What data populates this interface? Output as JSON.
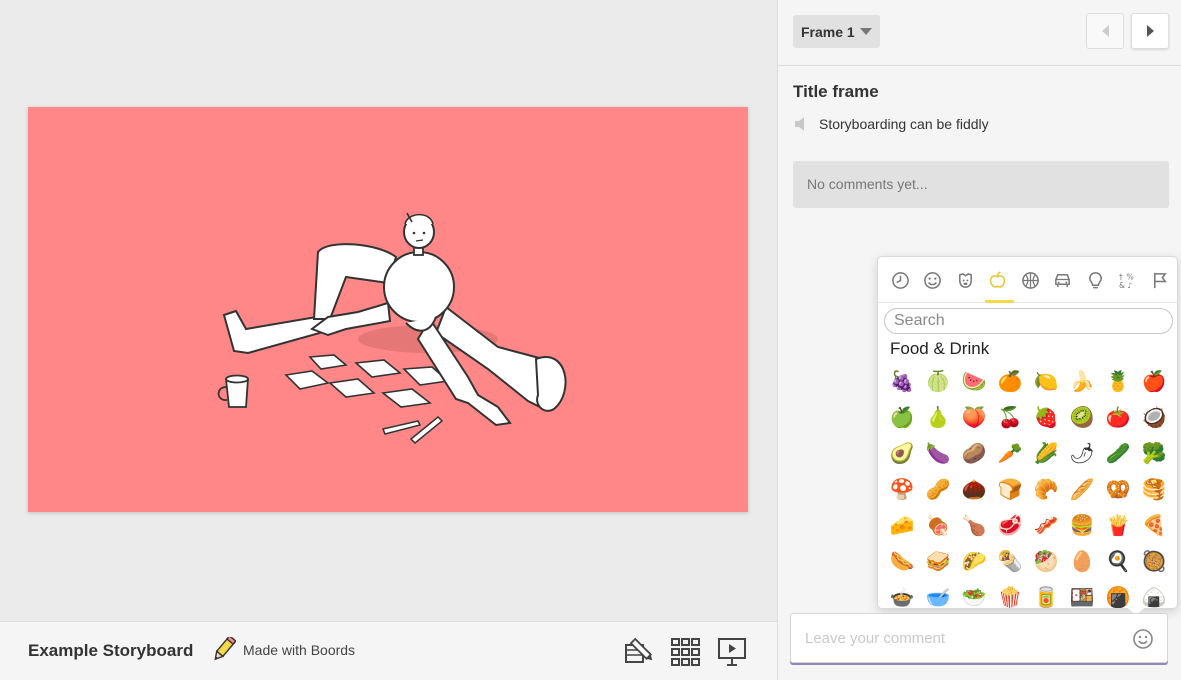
{
  "footer": {
    "project_title": "Example Storyboard",
    "made_with": "Made with Boords",
    "icons": [
      "edit-frames-icon",
      "grid-view-icon",
      "presentation-icon"
    ]
  },
  "sidebar": {
    "frame_select": "Frame 1",
    "frame_title": "Title frame",
    "frame_note": "Storyboarding can be fiddly",
    "comments_empty": "No comments yet..."
  },
  "emoji_picker": {
    "categories": [
      "recent-icon",
      "smileys-icon",
      "animals-icon",
      "food-icon",
      "activity-icon",
      "travel-icon",
      "objects-icon",
      "symbols-icon",
      "flags-icon"
    ],
    "active_category": "food-icon",
    "search_placeholder": "Search",
    "section_title": "Food & Drink",
    "emojis": [
      "🍇",
      "🍈",
      "🍉",
      "🍊",
      "🍋",
      "🍌",
      "🍍",
      "🍎",
      "🍏",
      "🍐",
      "🍑",
      "🍒",
      "🍓",
      "🥝",
      "🍅",
      "🥥",
      "🥑",
      "🍆",
      "🥔",
      "🥕",
      "🌽",
      "🌶",
      "🥒",
      "🥦",
      "🍄",
      "🥜",
      "🌰",
      "🍞",
      "🥐",
      "🥖",
      "🥨",
      "🥞",
      "🧀",
      "🍖",
      "🍗",
      "🥩",
      "🥓",
      "🍔",
      "🍟",
      "🍕",
      "🌭",
      "🥪",
      "🌮",
      "🌯",
      "🥙",
      "🥚",
      "🍳",
      "🥘",
      "🍲",
      "🥣",
      "🥗",
      "🍿",
      "🥫",
      "🍱",
      "🍘",
      "🍙"
    ],
    "accent_color": "#f5d949"
  },
  "comment": {
    "placeholder": "Leave your comment"
  },
  "colors": {
    "frame_background": "#ff8787",
    "comment_underline": "#8f86b9"
  }
}
